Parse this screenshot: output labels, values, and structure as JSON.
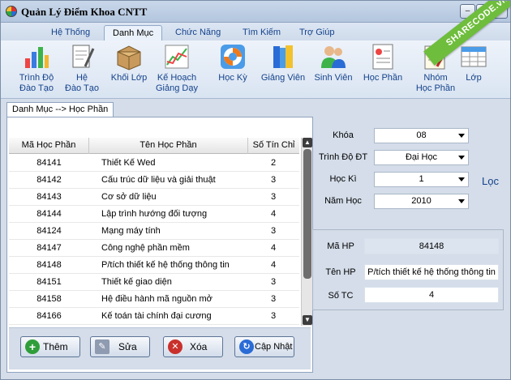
{
  "window": {
    "title": "Quản Lý Điểm Khoa CNTT",
    "ribbon_watermark": "SHARECODE.vn",
    "controls": {
      "minimize": "–",
      "maximize": "❐",
      "close": "✕"
    }
  },
  "menu": {
    "tabs": [
      {
        "label": "Hệ Thống"
      },
      {
        "label": "Danh Mục",
        "active": true
      },
      {
        "label": "Chức Năng"
      },
      {
        "label": "Tìm Kiếm"
      },
      {
        "label": "Trợ Giúp"
      }
    ]
  },
  "toolbar": {
    "items": [
      {
        "line1": "Trình Độ",
        "line2": "Đào Tạo",
        "icon": "bar-chart-icon"
      },
      {
        "line1": "Hệ",
        "line2": "Đào Tạo",
        "icon": "document-pen-icon"
      },
      {
        "line1": "Khối Lớp",
        "line2": "",
        "icon": "box-icon"
      },
      {
        "line1": "Kế Hoạch",
        "line2": "Giảng Dạy",
        "icon": "line-chart-icon"
      },
      {
        "line1": "Học Kỳ",
        "line2": "",
        "icon": "lifebuoy-icon"
      },
      {
        "line1": "Giảng Viên",
        "line2": "",
        "icon": "books-icon"
      },
      {
        "line1": "Sinh Viên",
        "line2": "",
        "icon": "users-icon"
      },
      {
        "line1": "Học Phần",
        "line2": "",
        "icon": "report-icon"
      },
      {
        "line1": "Nhóm",
        "line2": "Học Phần",
        "icon": "notepad-icon"
      },
      {
        "line1": "Lớp",
        "line2": "",
        "icon": "table-icon"
      }
    ]
  },
  "breadcrumb": "Danh Mục --> Học Phần",
  "grid": {
    "columns": [
      "Mã Học Phần",
      "Tên Học Phần",
      "Số Tín Chỉ"
    ],
    "rows": [
      [
        "84141",
        "Thiết Kế Wed",
        "2"
      ],
      [
        "84142",
        "Cấu trúc dữ liệu và giải thuật",
        "3"
      ],
      [
        "84143",
        "Cơ sở dữ liệu",
        "3"
      ],
      [
        "84144",
        "Lập trình hướng đối tượng",
        "4"
      ],
      [
        "84124",
        "Mạng máy tính",
        "3"
      ],
      [
        "84147",
        "Công nghệ phần mềm",
        "4"
      ],
      [
        "84148",
        "P/tích thiết kế hệ thống thông tin",
        "4"
      ],
      [
        "84151",
        "Thiết kế giao diện",
        "3"
      ],
      [
        "84158",
        "Hệ điều hành mã nguồn mở",
        "3"
      ],
      [
        "84166",
        "Kế toán tài chính đại cương",
        "3"
      ]
    ]
  },
  "actions": {
    "add": "Thêm",
    "edit": "Sửa",
    "delete": "Xóa",
    "update": "Cập Nhật"
  },
  "filters": {
    "khoa": {
      "label": "Khóa",
      "value": "08"
    },
    "trinh_do": {
      "label": "Trình Độ ĐT",
      "value": "Đại Học"
    },
    "hoc_ki": {
      "label": "Học Kì",
      "value": "1"
    },
    "nam_hoc": {
      "label": "Năm Học",
      "value": "2010"
    },
    "loc_label": "Lọc"
  },
  "detail": {
    "ma_hp": {
      "label": "Mã HP",
      "value": "84148"
    },
    "ten_hp": {
      "label": "Tên HP",
      "value": "P/tích thiết kế hệ thống thông tin"
    },
    "so_tc": {
      "label": "Số TC",
      "value": "4"
    }
  },
  "colors": {
    "accent": "#15428b",
    "ribbon_green": "#6ebd3c",
    "add_green": "#2f9e3a",
    "delete_red": "#c9302c",
    "update_blue": "#2a6cd6"
  }
}
